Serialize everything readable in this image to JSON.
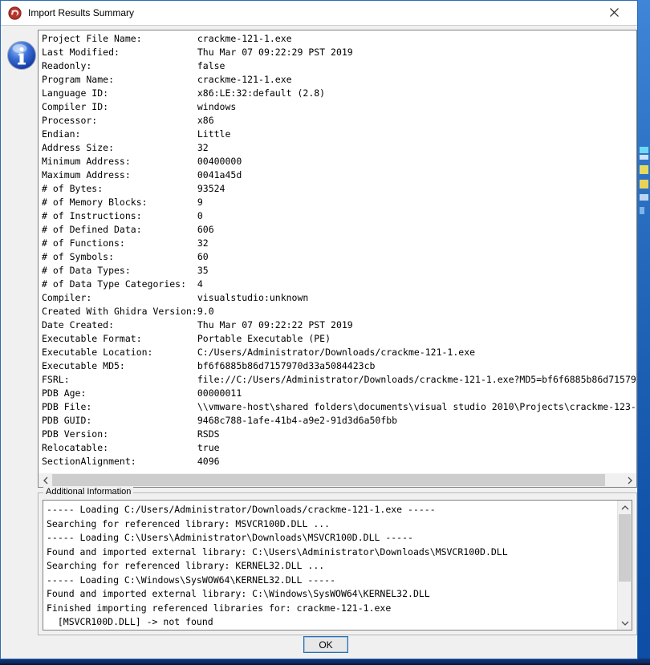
{
  "window": {
    "title": "Import Results Summary"
  },
  "icons": {
    "app_icon": "ghidra-dragon",
    "message_icon": "information",
    "close": "×",
    "scroll_left": "‹",
    "scroll_right": "›",
    "scroll_up": "ˆ",
    "scroll_down": "ˇ"
  },
  "summary": {
    "rows": [
      {
        "label": "Project File Name:",
        "value": "crackme-121-1.exe"
      },
      {
        "label": "Last Modified:",
        "value": "Thu Mar 07 09:22:29 PST 2019"
      },
      {
        "label": "Readonly:",
        "value": "false"
      },
      {
        "label": "Program Name:",
        "value": "crackme-121-1.exe"
      },
      {
        "label": "Language ID:",
        "value": "x86:LE:32:default (2.8)"
      },
      {
        "label": "Compiler ID:",
        "value": "windows"
      },
      {
        "label": "Processor:",
        "value": "x86"
      },
      {
        "label": "Endian:",
        "value": "Little"
      },
      {
        "label": "Address Size:",
        "value": "32"
      },
      {
        "label": "Minimum Address:",
        "value": "00400000"
      },
      {
        "label": "Maximum Address:",
        "value": "0041a45d"
      },
      {
        "label": "# of Bytes:",
        "value": "93524"
      },
      {
        "label": "# of Memory Blocks:",
        "value": "9"
      },
      {
        "label": "# of Instructions:",
        "value": "0"
      },
      {
        "label": "# of Defined Data:",
        "value": "606"
      },
      {
        "label": "# of Functions:",
        "value": "32"
      },
      {
        "label": "# of Symbols:",
        "value": "60"
      },
      {
        "label": "# of Data Types:",
        "value": "35"
      },
      {
        "label": "# of Data Type Categories:",
        "value": "4"
      },
      {
        "label": "Compiler:",
        "value": "visualstudio:unknown"
      },
      {
        "label": "Created With Ghidra Version:",
        "value": "9.0"
      },
      {
        "label": "Date Created:",
        "value": "Thu Mar 07 09:22:22 PST 2019"
      },
      {
        "label": "Executable Format:",
        "value": "Portable Executable (PE)"
      },
      {
        "label": "Executable Location:",
        "value": "C:/Users/Administrator/Downloads/crackme-121-1.exe"
      },
      {
        "label": "Executable MD5:",
        "value": "bf6f6885b86d7157970d33a5084423cb"
      },
      {
        "label": "FSRL:",
        "value": "file://C:/Users/Administrator/Downloads/crackme-121-1.exe?MD5=bf6f6885b86d71579"
      },
      {
        "label": "PDB Age:",
        "value": "00000011"
      },
      {
        "label": "PDB File:",
        "value": "\\\\vmware-host\\shared folders\\documents\\visual studio 2010\\Projects\\crackme-123-"
      },
      {
        "label": "PDB GUID:",
        "value": "9468c788-1afe-41b4-a9e2-91d3d6a50fbb"
      },
      {
        "label": "PDB Version:",
        "value": "RSDS"
      },
      {
        "label": "Relocatable:",
        "value": "true"
      },
      {
        "label": "SectionAlignment:",
        "value": "4096"
      }
    ]
  },
  "additional_info": {
    "title": "Additional Information",
    "lines": [
      "----- Loading C:/Users/Administrator/Downloads/crackme-121-1.exe -----",
      "Searching for referenced library: MSVCR100D.DLL ...",
      "----- Loading C:\\Users\\Administrator\\Downloads\\MSVCR100D.DLL -----",
      "Found and imported external library: C:\\Users\\Administrator\\Downloads\\MSVCR100D.DLL",
      "Searching for referenced library: KERNEL32.DLL ...",
      "----- Loading C:\\Windows\\SysWOW64\\KERNEL32.DLL -----",
      "Found and imported external library: C:\\Windows\\SysWOW64\\KERNEL32.DLL",
      "Finished importing referenced libraries for: crackme-121-1.exe",
      "  [MSVCR100D.DLL] -> not found"
    ]
  },
  "footer": {
    "ok_label": "OK"
  },
  "colors": {
    "dialog_border": "#2f6bb3",
    "titlebar_bg": "#ffffff",
    "dialog_bg": "#f0f0f0",
    "panel_bg": "#ffffff",
    "panel_border": "#828282",
    "scroll_thumb": "#cdcdcd",
    "ok_focus_border": "#2d6daf",
    "background_strip": "#2368ba",
    "bottom_strip": "#0d2a66",
    "info_icon_blue": "#1d4fbe",
    "ghidra_red": "#b5342b"
  }
}
